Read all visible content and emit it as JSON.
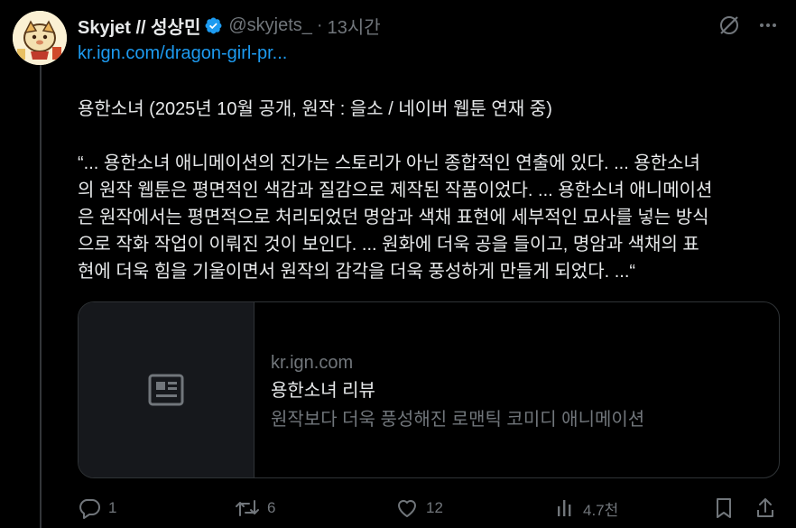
{
  "colors": {
    "background": "#000000",
    "text": "#e7e9ea",
    "muted": "#71767b",
    "link": "#1d9bf0",
    "verified": "#1d9bf0",
    "border": "#2f3336"
  },
  "tweet": {
    "author_name": "Skyjet // 성상민",
    "verified_icon": "verified-badge-icon",
    "handle": "@skyjets_",
    "separator": "·",
    "time": "13시간",
    "link_text": "kr.ign.com/dragon-girl-pr...",
    "paragraph1": "용한소녀 (2025년 10월 공개, 원작 : 을소 / 네이버 웹툰 연재 중)",
    "paragraph2_lines": [
      "“... 용한소녀 애니메이션의 진가는 스토리가 아닌 종합적인 연출에 있다. ... 용한소녀",
      "의 원작 웹툰은 평면적인 색감과 질감으로 제작된 작품이었다. ... 용한소녀 애니메이션",
      "은 원작에서는 평면적으로 처리되었던 명암과 색채 표현에 세부적인 묘사를 넣는 방식",
      "으로 작화 작업이 이뤄진 것이 보인다. ... 원화에 더욱 공을 들이고, 명암과 색채의 표",
      "현에 더욱 힘을 기울이면서 원작의 감각을 더욱 풍성하게 만들게 되었다. ...“"
    ]
  },
  "card": {
    "thumb_icon": "article-icon",
    "domain": "kr.ign.com",
    "title": "용한소녀 리뷰",
    "description": "원작보다 더욱 풍성해진 로맨틱 코미디 애니메이션"
  },
  "actions": {
    "reply_count": "1",
    "retweet_count": "6",
    "like_count": "12",
    "views_count": "4.7천"
  }
}
